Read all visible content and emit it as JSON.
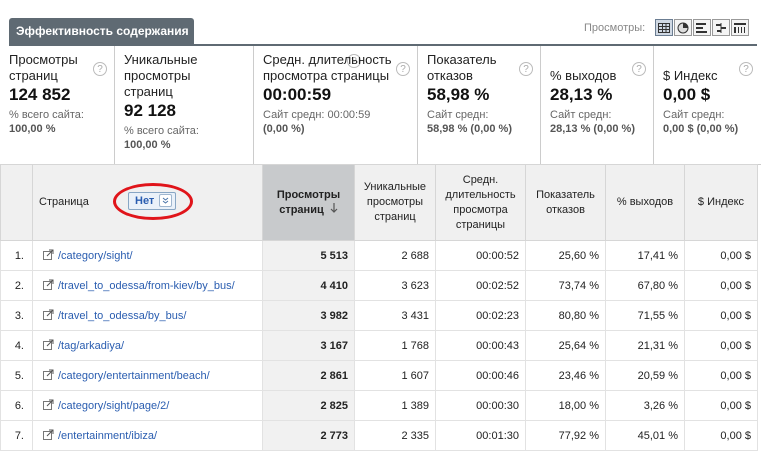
{
  "tab": {
    "title": "Эффективность содержания"
  },
  "views": {
    "label": "Просмотры:",
    "buttons": [
      "table-icon",
      "pie-icon",
      "bar-icon",
      "comparison-icon",
      "pivot-icon"
    ],
    "active": "table-icon"
  },
  "metrics": [
    {
      "title": "Просмотры страниц",
      "value": "124 852",
      "sub1": "% всего сайта:",
      "sub2": "100,00 %"
    },
    {
      "title": "Уникальные просмотры страниц",
      "value": "92 128",
      "sub1": "% всего сайта:",
      "sub2": "100,00 %"
    },
    {
      "title": "Средн. длительность просмотра страницы",
      "value": "00:00:59",
      "sub1": "Сайт средн: 00:00:59",
      "sub2": "(0,00 %)"
    },
    {
      "title": "Показатель отказов",
      "value": "58,98 %",
      "sub1": "Сайт средн:",
      "sub2": "58,98 % (0,00 %)"
    },
    {
      "title": "% выходов",
      "value": "28,13 %",
      "sub1": "Сайт средн:",
      "sub2": "28,13 % (0,00 %)"
    },
    {
      "title": "$ Индекс",
      "value": "0,00 $",
      "sub1": "Сайт средн:",
      "sub2": "0,00 $ (0,00 %)"
    }
  ],
  "table": {
    "headers": {
      "page": "Страница",
      "dropdown": "Нет",
      "pageviews": "Просмотры страниц",
      "unique": "Уникальные просмотры страниц",
      "avgtime": "Средн. длительность просмотра страницы",
      "bounce": "Показатель отказов",
      "exit": "% выходов",
      "index": "$ Индекс"
    },
    "rows": [
      {
        "n": "1.",
        "page": "/category/sight/",
        "pv": "5 513",
        "u": "2 688",
        "t": "00:00:52",
        "b": "25,60 %",
        "e": "17,41 %",
        "i": "0,00 $"
      },
      {
        "n": "2.",
        "page": "/travel_to_odessa/from-kiev/by_bus/",
        "pv": "4 410",
        "u": "3 623",
        "t": "00:02:52",
        "b": "73,74 %",
        "e": "67,80 %",
        "i": "0,00 $"
      },
      {
        "n": "3.",
        "page": "/travel_to_odessa/by_bus/",
        "pv": "3 982",
        "u": "3 431",
        "t": "00:02:23",
        "b": "80,80 %",
        "e": "71,55 %",
        "i": "0,00 $"
      },
      {
        "n": "4.",
        "page": "/tag/arkadiya/",
        "pv": "3 167",
        "u": "1 768",
        "t": "00:00:43",
        "b": "25,64 %",
        "e": "21,31 %",
        "i": "0,00 $"
      },
      {
        "n": "5.",
        "page": "/category/entertainment/beach/",
        "pv": "2 861",
        "u": "1 607",
        "t": "00:00:46",
        "b": "23,46 %",
        "e": "20,59 %",
        "i": "0,00 $"
      },
      {
        "n": "6.",
        "page": "/category/sight/page/2/",
        "pv": "2 825",
        "u": "1 389",
        "t": "00:00:30",
        "b": "18,00 %",
        "e": "3,26 %",
        "i": "0,00 $"
      },
      {
        "n": "7.",
        "page": "/entertainment/ibiza/",
        "pv": "2 773",
        "u": "2 335",
        "t": "00:01:30",
        "b": "77,92 %",
        "e": "45,01 %",
        "i": "0,00 $"
      }
    ]
  },
  "colors": {
    "tab": "#5f6a73",
    "link": "#2a5db0",
    "annotation": "#e0141a",
    "sorted_header": "#c8cacc"
  }
}
